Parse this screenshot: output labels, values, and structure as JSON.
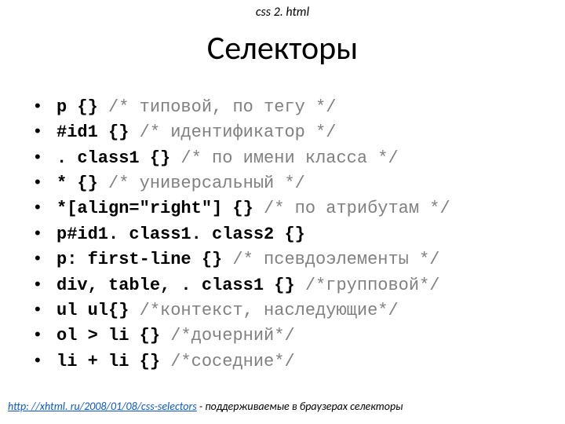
{
  "tag": "css 2. html",
  "title": "Селекторы",
  "items": [
    {
      "sel": "p {}",
      "comment": " /* типовой, по тегу */"
    },
    {
      "sel": "#id1 {}",
      "comment": " /* идентификатор */"
    },
    {
      "sel": ". class1 {}",
      "comment": " /* по имени класса */"
    },
    {
      "sel": "* {}",
      "comment": " /* универсальный */"
    },
    {
      "sel": "*[align=\"right\"] {}",
      "comment": " /* по атрибутам */"
    },
    {
      "sel": "p#id1. class1. class2 {}",
      "comment": ""
    },
    {
      "sel": "p: first-line {}",
      "comment": " /* псевдоэлементы */"
    },
    {
      "sel": "div, table, . class1 {}",
      "comment": " /*групповой*/"
    },
    {
      "sel": "ul ul{}",
      "comment": " /*контекст, наследующие*/"
    },
    {
      "sel": "ol > li {}",
      "comment": " /*дочерний*/"
    },
    {
      "sel": "li + li {}",
      "comment": " /*соседние*/"
    }
  ],
  "footer": {
    "link_text": "http: //xhtml. ru/2008/01/08/css-selectors",
    "link_href": "http://xhtml.ru/2008/01/08/css-selectors",
    "note": " - поддерживаемые в браузерах селекторы"
  }
}
